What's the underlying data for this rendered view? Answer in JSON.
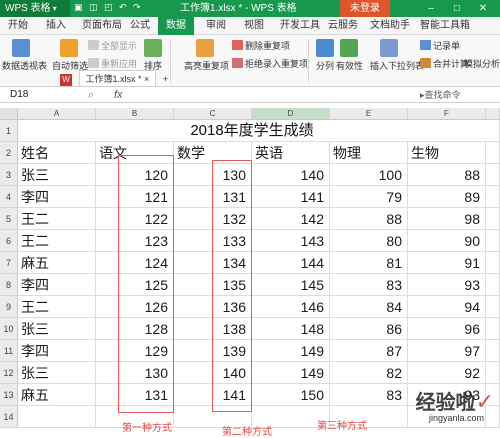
{
  "titlebar": {
    "app_label": "WPS 表格",
    "doc_title": "工作簿1.xlsx * - WPS 表格",
    "login_label": "未登录"
  },
  "menu_tabs": [
    "开始",
    "插入",
    "页面布局",
    "公式",
    "数据",
    "审阅",
    "视图",
    "开发工具",
    "云服务",
    "文档助手",
    "智能工具箱"
  ],
  "active_tab": "数据",
  "ribbon": {
    "pivot": "数据透视表",
    "autofilter": "自动筛选",
    "show_all": "全部显示",
    "reapply": "重新应用",
    "sort": "排序",
    "highlight_dup": "高亮重复项",
    "remove_dup": "删除重复项",
    "reject_dup": "拒绝录入重复项",
    "split": "分列",
    "validity": "有效性",
    "dropdown": "插入下拉列表",
    "records": "记录单",
    "consolidate": "合并计算",
    "whatif": "模拟分析"
  },
  "doc_tab": "工作簿1.xlsx *",
  "formula_bar": {
    "name_box": "D18",
    "fx": "fx",
    "search_hint": "查找命令"
  },
  "columns": [
    "A",
    "B",
    "C",
    "D",
    "E",
    "F"
  ],
  "rows": [
    "1",
    "2",
    "3",
    "4",
    "5",
    "6",
    "7",
    "8",
    "9",
    "10",
    "11",
    "12",
    "13",
    "14"
  ],
  "sheet": {
    "title": "2018年度学生成绩",
    "headers": [
      "姓名",
      "语文",
      "数学",
      "英语",
      "物理",
      "生物"
    ],
    "data": [
      [
        "张三",
        "120",
        "130",
        "140",
        "100",
        "88"
      ],
      [
        "李四",
        "121",
        "131",
        "141",
        "79",
        "89"
      ],
      [
        "王二",
        "122",
        "132",
        "142",
        "88",
        "98"
      ],
      [
        "王二",
        "123",
        "133",
        "143",
        "80",
        "90"
      ],
      [
        "麻五",
        "124",
        "134",
        "144",
        "81",
        "91"
      ],
      [
        "李四",
        "125",
        "135",
        "145",
        "83",
        "93"
      ],
      [
        "王二",
        "126",
        "136",
        "146",
        "84",
        "94"
      ],
      [
        "张三",
        "128",
        "138",
        "148",
        "86",
        "96"
      ],
      [
        "李四",
        "129",
        "139",
        "149",
        "87",
        "97"
      ],
      [
        "张三",
        "130",
        "140",
        "149",
        "82",
        "92"
      ],
      [
        "麻五",
        "131",
        "141",
        "150",
        "83",
        "93"
      ]
    ]
  },
  "annotations": {
    "method1": "第一种方式",
    "method2": "第二种方式",
    "method3": "第三种方式"
  },
  "watermark": {
    "main": "经验啦",
    "sub": "jingyanla.com"
  },
  "colors": {
    "brand_green": "#16994c",
    "annotation_red": "#e55a5a"
  }
}
